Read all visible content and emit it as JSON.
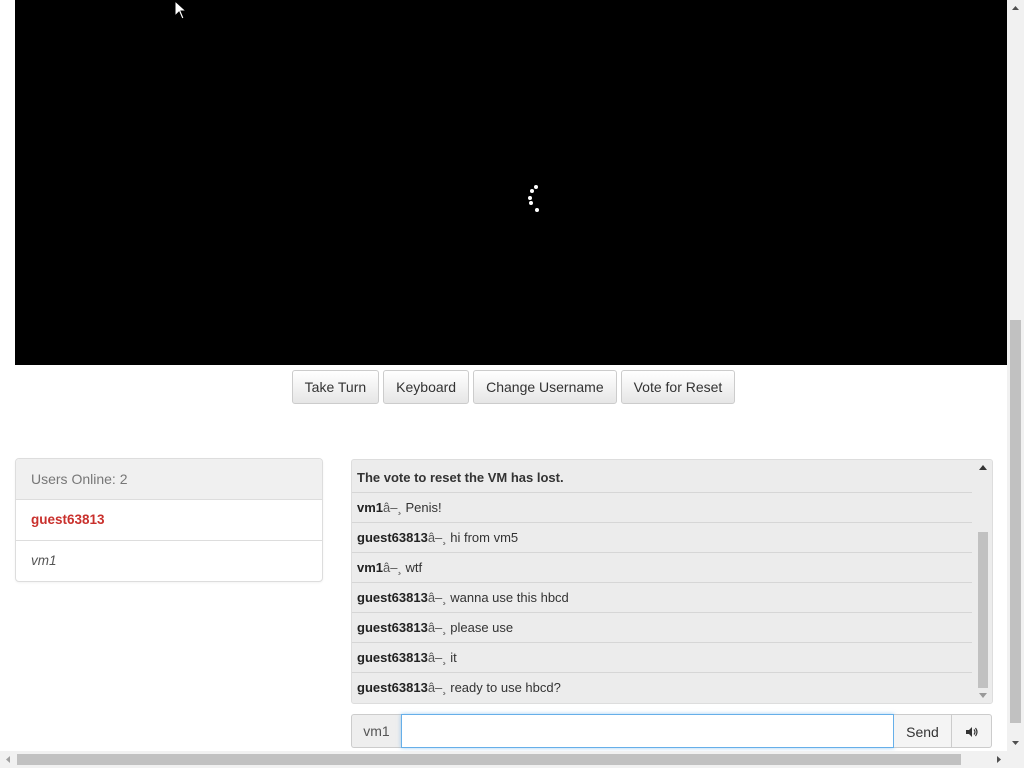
{
  "vm_screen": {
    "background": "#000000",
    "loading_indicator": "spinner-icon"
  },
  "toolbar": {
    "take_turn": "Take Turn",
    "keyboard": "Keyboard",
    "change_username": "Change Username",
    "vote_reset": "Vote for Reset"
  },
  "users": {
    "heading": "Users Online: 2",
    "list": [
      {
        "name": "guest63813",
        "current": true
      },
      {
        "name": "vm1",
        "current": false
      }
    ]
  },
  "chat": {
    "separator": "â–¸",
    "messages": [
      {
        "user": "",
        "text": "The vote to reset the VM has lost."
      },
      {
        "user": "vm1",
        "text": "Penis!"
      },
      {
        "user": "guest63813",
        "text": "hi from vm5"
      },
      {
        "user": "vm1",
        "text": "wtf"
      },
      {
        "user": "guest63813",
        "text": "wanna use this hbcd"
      },
      {
        "user": "guest63813",
        "text": "please use"
      },
      {
        "user": "guest63813",
        "text": "it"
      },
      {
        "user": "guest63813",
        "text": "ready to use hbcd?"
      }
    ],
    "input": {
      "username_label": "vm1",
      "value": "",
      "send_label": "Send",
      "sound_icon": "speaker-icon"
    }
  },
  "colors": {
    "current_user": "#c9302c",
    "input_focus": "#66afe9"
  }
}
